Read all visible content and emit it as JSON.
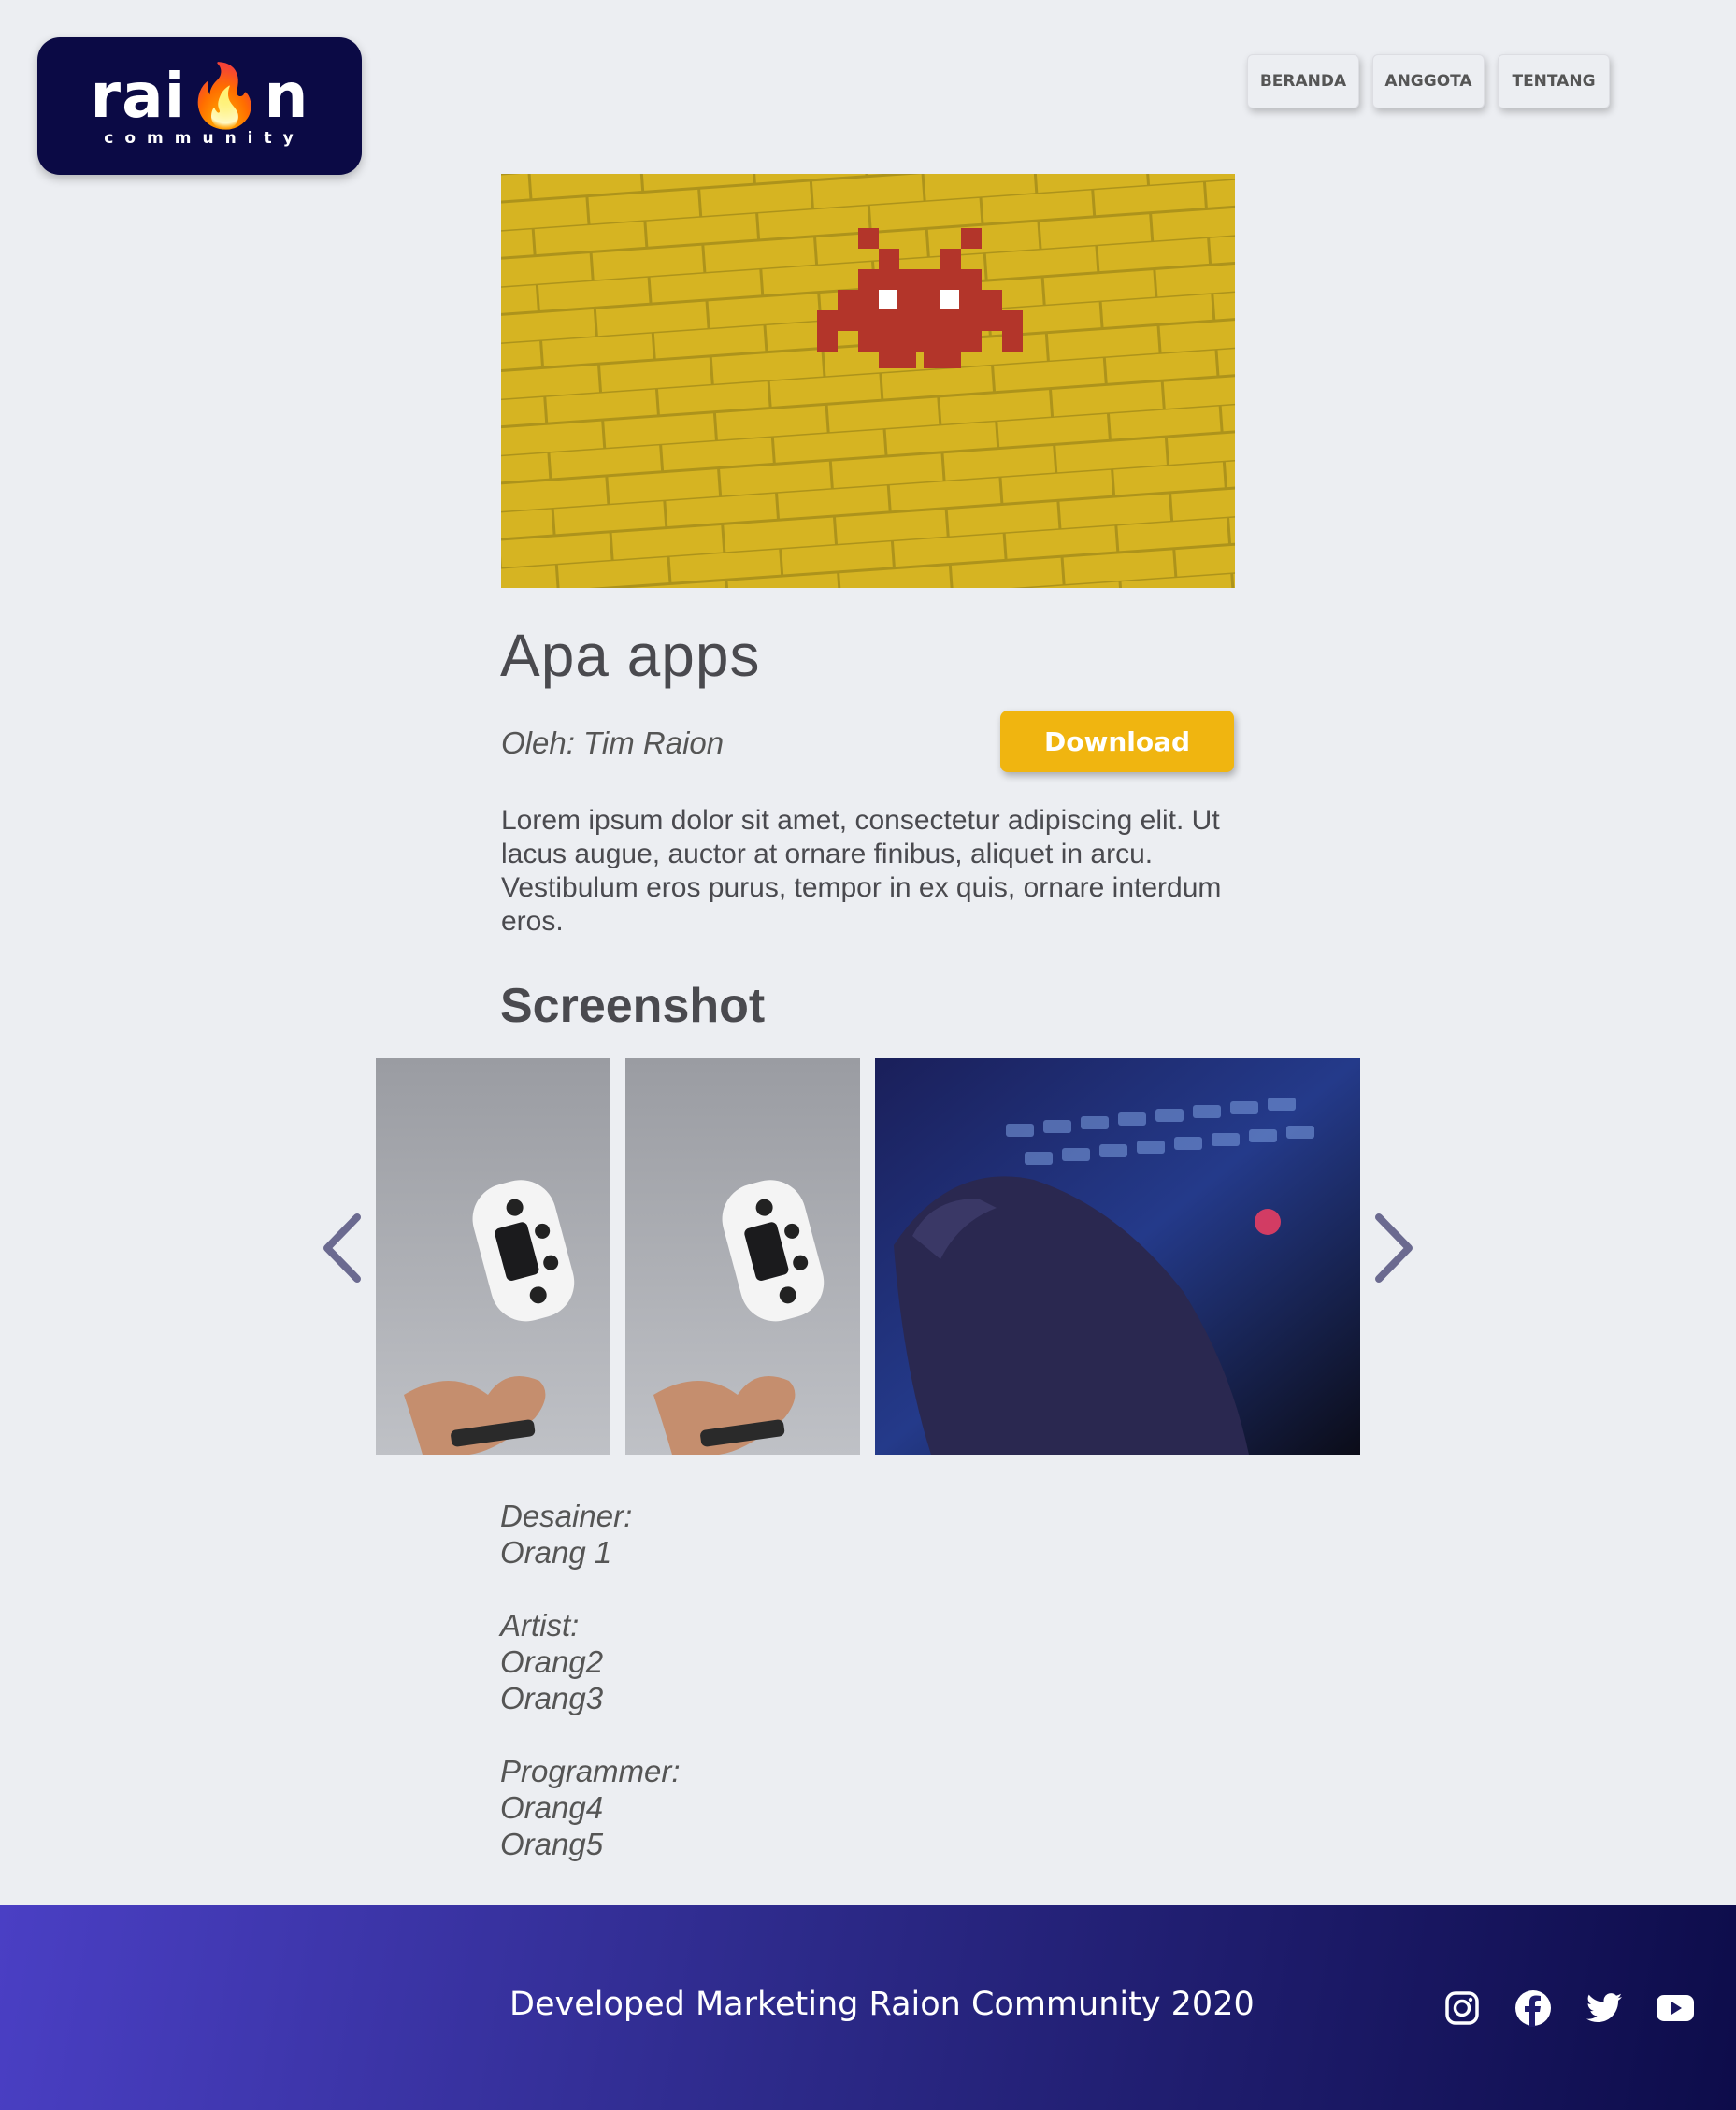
{
  "header": {
    "logo_word": "rai",
    "logo_word_end": "n",
    "logo_sub": "community",
    "nav": [
      {
        "label": "BERANDA"
      },
      {
        "label": "ANGGOTA"
      },
      {
        "label": "TENTANG"
      }
    ]
  },
  "app": {
    "title": "Apa apps",
    "author": "Oleh: Tim Raion",
    "download_label": "Download",
    "description": "Lorem ipsum dolor sit amet, consectetur adipiscing elit. Ut lacus augue, auctor at ornare finibus, aliquet in arcu. Vestibulum eros purus, tempor in ex quis, ornare interdum eros."
  },
  "gallery": {
    "heading": "Screenshot",
    "icons": {
      "prev": "chevron-left-icon",
      "next": "chevron-right-icon"
    }
  },
  "credits": {
    "designer_label": "Desainer:",
    "designers": [
      "Orang 1"
    ],
    "artist_label": "Artist:",
    "artists": [
      "Orang2",
      "Orang3"
    ],
    "programmer_label": "Programmer:",
    "programmers": [
      "Orang4",
      "Orang5"
    ]
  },
  "footer": {
    "text": "Developed Marketing Raion Community 2020",
    "social": [
      "instagram-icon",
      "facebook-icon",
      "twitter-icon",
      "youtube-icon"
    ]
  },
  "colors": {
    "background": "#eceef2",
    "logo_bg": "#0b0a45",
    "accent": "#f0b510",
    "arrow": "#6b6a90"
  }
}
